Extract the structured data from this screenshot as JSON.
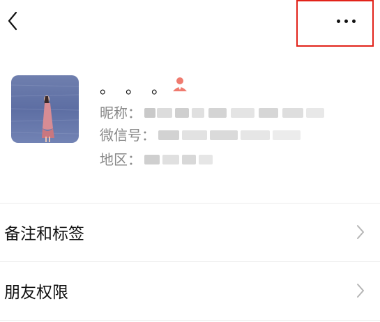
{
  "top_bar": {
    "back_icon": "chevron-left-icon",
    "more_icon": "more-dots-icon",
    "highlight_color": "#e2231a"
  },
  "profile": {
    "display_name": "。。。",
    "badge_icon": "person-icon",
    "badge_color": "#ef7b6f",
    "nickname_label": "昵称：",
    "wechat_id_label": "微信号：",
    "region_label": "地区："
  },
  "menu": {
    "items": [
      {
        "label": "备注和标签",
        "icon": "chevron-right-icon"
      },
      {
        "label": "朋友权限",
        "icon": "chevron-right-icon"
      }
    ]
  }
}
